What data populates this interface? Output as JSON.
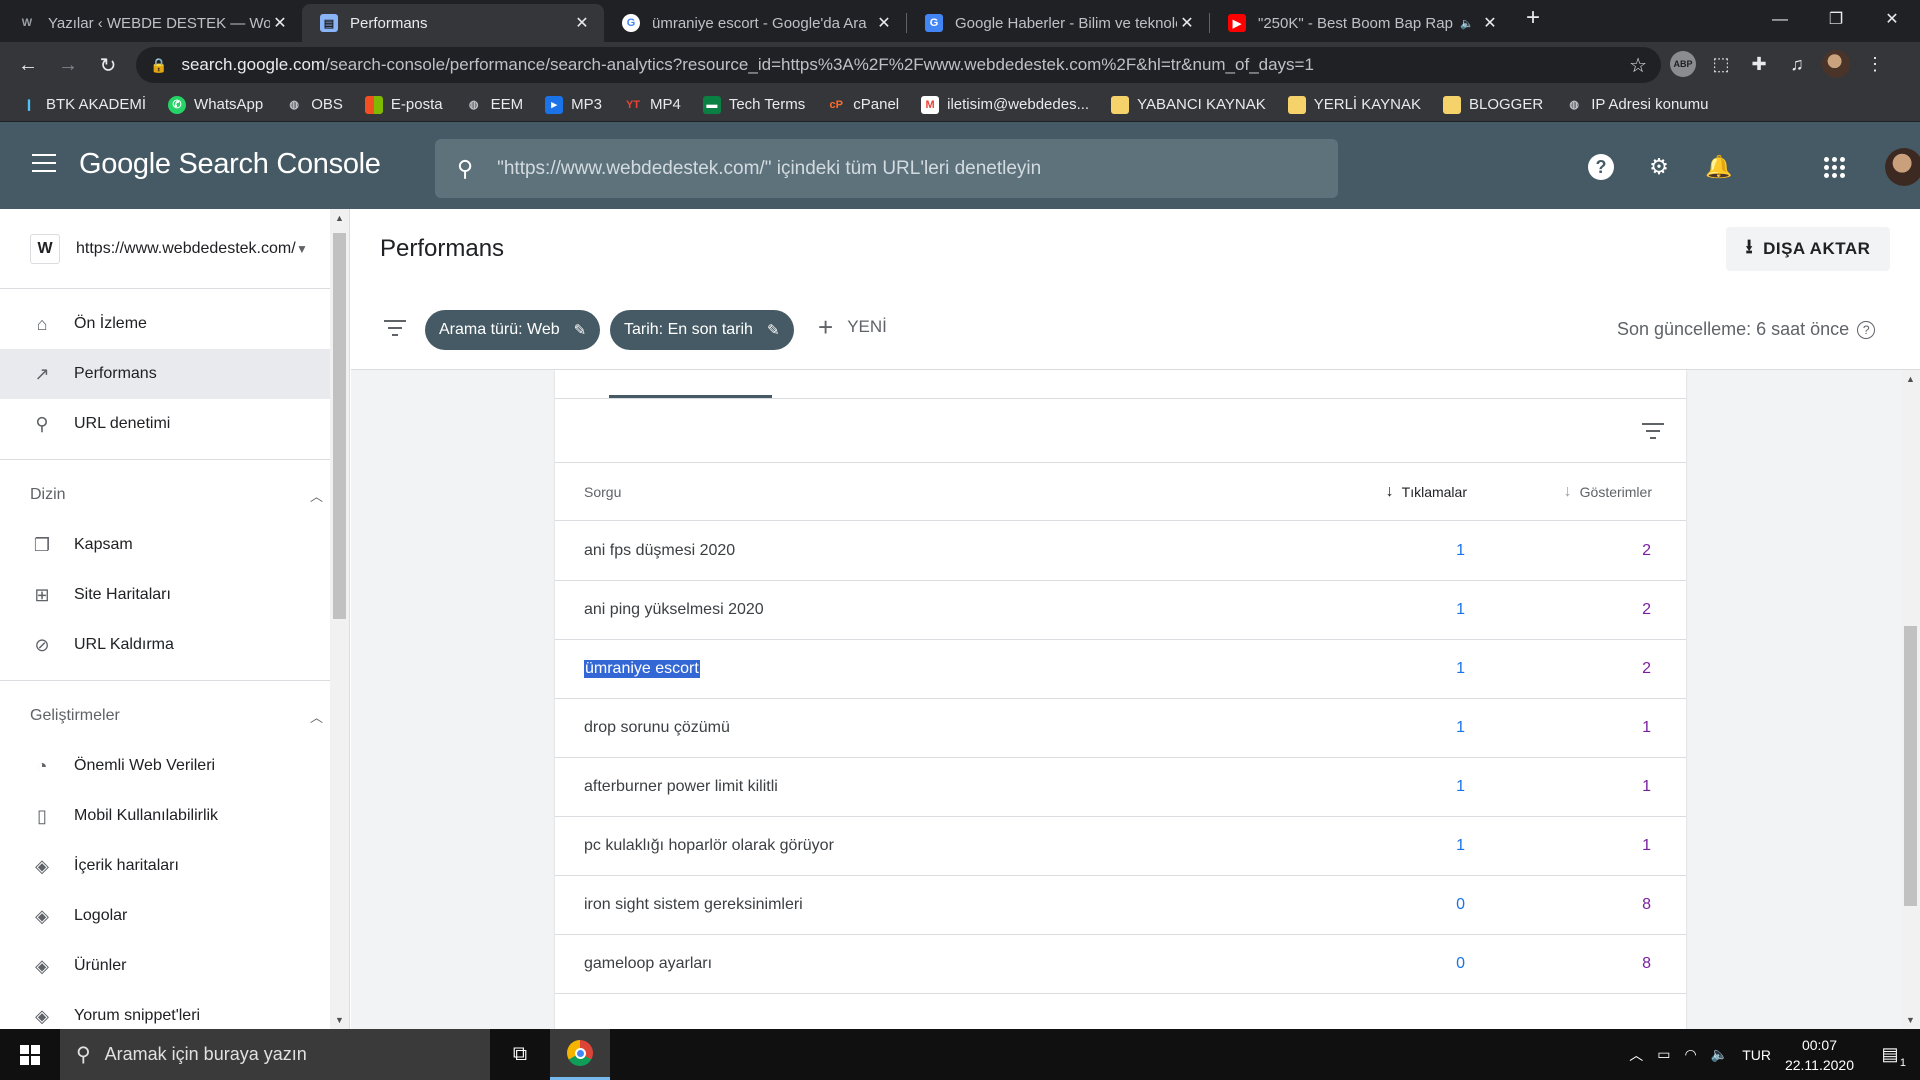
{
  "browser": {
    "tabs": [
      {
        "title": "Yazılar ‹ WEBDE DESTEK — WordPress",
        "icon": "wordpress-icon",
        "active": false
      },
      {
        "title": "Performans",
        "icon": "search-console-icon",
        "active": true
      },
      {
        "title": "ümraniye escort - Google'da Ara",
        "icon": "google-icon",
        "active": false
      },
      {
        "title": "Google Haberler - Bilim ve teknoloji",
        "icon": "google-news-icon",
        "active": false
      },
      {
        "title": "\"250K\" - Best Boom Bap Rap",
        "icon": "youtube-icon",
        "active": false
      }
    ],
    "url_host": "search.google.com",
    "url_path": "/search-console/performance/search-analytics?resource_id=https%3A%2F%2Fwww.webdedestek.com%2F&hl=tr&num_of_days=1",
    "extensions": [
      "ABP"
    ],
    "bookmarks": [
      {
        "label": "BTK AKADEMİ",
        "icon": "btk-icon"
      },
      {
        "label": "WhatsApp",
        "icon": "whatsapp-icon"
      },
      {
        "label": "OBS",
        "icon": "globe-icon"
      },
      {
        "label": "E-posta",
        "icon": "microsoft-icon"
      },
      {
        "label": "EEM",
        "icon": "globe-icon"
      },
      {
        "label": "MP3",
        "icon": "mp3-icon"
      },
      {
        "label": "MP4",
        "icon": "yt-icon"
      },
      {
        "label": "Tech Terms",
        "icon": "techterms-icon"
      },
      {
        "label": "cPanel",
        "icon": "cpanel-icon"
      },
      {
        "label": "iletisim@webdedes...",
        "icon": "mail-icon"
      },
      {
        "label": "YABANCI KAYNAK",
        "icon": "folder-icon"
      },
      {
        "label": "YERLİ KAYNAK",
        "icon": "folder-icon"
      },
      {
        "label": "BLOGGER",
        "icon": "folder-icon"
      },
      {
        "label": "IP Adresi konumu",
        "icon": "globe-icon"
      }
    ]
  },
  "header": {
    "brand": "Google Search Console",
    "search_placeholder": "\"https://www.webdedestek.com/\" içindeki tüm URL'leri denetleyin"
  },
  "sidebar": {
    "property": "https://www.webdedestek.com/",
    "property_logo": "W",
    "top_items": [
      {
        "label": "Ön İzleme",
        "icon": "home-icon",
        "active": false
      },
      {
        "label": "Performans",
        "icon": "trending-up-icon",
        "active": true
      },
      {
        "label": "URL denetimi",
        "icon": "search-icon",
        "active": false
      }
    ],
    "index_section": {
      "title": "Dizin",
      "items": [
        {
          "label": "Kapsam",
          "icon": "copy-icon"
        },
        {
          "label": "Site Haritaları",
          "icon": "sitemap-icon"
        },
        {
          "label": "URL Kaldırma",
          "icon": "eye-off-icon"
        }
      ]
    },
    "enhance_section": {
      "title": "Geliştirmeler",
      "items": [
        {
          "label": "Önemli Web Verileri",
          "icon": "speedometer-icon"
        },
        {
          "label": "Mobil Kullanılabilirlik",
          "icon": "smartphone-icon"
        },
        {
          "label": "İçerik haritaları",
          "icon": "layers-icon"
        },
        {
          "label": "Logolar",
          "icon": "layers-icon"
        },
        {
          "label": "Ürünler",
          "icon": "layers-icon"
        },
        {
          "label": "Yorum snippet'leri",
          "icon": "layers-icon"
        }
      ]
    }
  },
  "main": {
    "title": "Performans",
    "export_label": "DIŞA AKTAR",
    "filters": [
      {
        "label": "Arama türü: Web"
      },
      {
        "label": "Tarih: En son tarih"
      }
    ],
    "new_label": "YENİ",
    "last_update": "Son güncelleme: 6 saat önce",
    "table": {
      "columns": [
        "Sorgu",
        "Tıklamalar",
        "Gösterimler"
      ],
      "sort_column": "Tıklamalar",
      "rows": [
        {
          "query": "ani fps düşmesi 2020",
          "clicks": "1",
          "impressions": "2",
          "selected": false
        },
        {
          "query": "ani ping yükselmesi 2020",
          "clicks": "1",
          "impressions": "2",
          "selected": false
        },
        {
          "query": "ümraniye escort",
          "clicks": "1",
          "impressions": "2",
          "selected": true
        },
        {
          "query": "drop sorunu çözümü",
          "clicks": "1",
          "impressions": "1",
          "selected": false
        },
        {
          "query": "afterburner power limit kilitli",
          "clicks": "1",
          "impressions": "1",
          "selected": false
        },
        {
          "query": "pc kulaklığı hoparlör olarak görüyor",
          "clicks": "1",
          "impressions": "1",
          "selected": false
        },
        {
          "query": "iron sight sistem gereksinimleri",
          "clicks": "0",
          "impressions": "8",
          "selected": false
        },
        {
          "query": "gameloop ayarları",
          "clicks": "0",
          "impressions": "8",
          "selected": false
        }
      ]
    }
  },
  "taskbar": {
    "search_placeholder": "Aramak için buraya yazın",
    "language": "TUR",
    "time": "00:07",
    "date": "22.11.2020",
    "notification_count": "1"
  },
  "colors": {
    "header_bg": "#455a64",
    "clicks": "#1a73e8",
    "impressions": "#7b1fa2",
    "selection": "#3367d6"
  }
}
